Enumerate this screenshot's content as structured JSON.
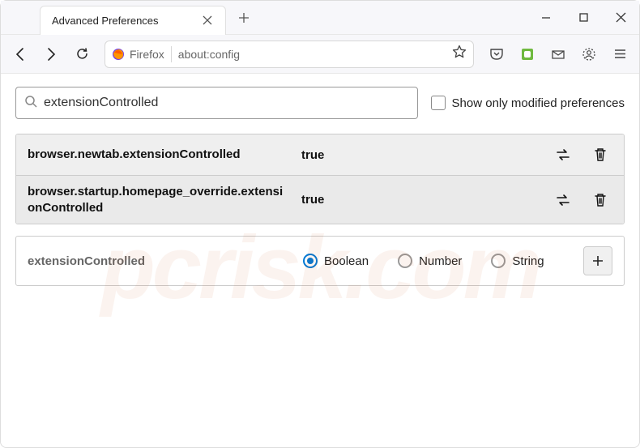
{
  "tab": {
    "title": "Advanced Preferences"
  },
  "urlbar": {
    "brand": "Firefox",
    "address": "about:config"
  },
  "search": {
    "value": "extensionControlled",
    "checkbox_label": "Show only modified preferences"
  },
  "prefs": [
    {
      "name": "browser.newtab.extensionControlled",
      "value": "true"
    },
    {
      "name": "browser.startup.homepage_override.extensionControlled",
      "value": "true"
    }
  ],
  "new_pref": {
    "name": "extensionControlled",
    "types": [
      {
        "label": "Boolean",
        "checked": true
      },
      {
        "label": "Number",
        "checked": false
      },
      {
        "label": "String",
        "checked": false
      }
    ]
  },
  "watermark": "pcrisk.com"
}
